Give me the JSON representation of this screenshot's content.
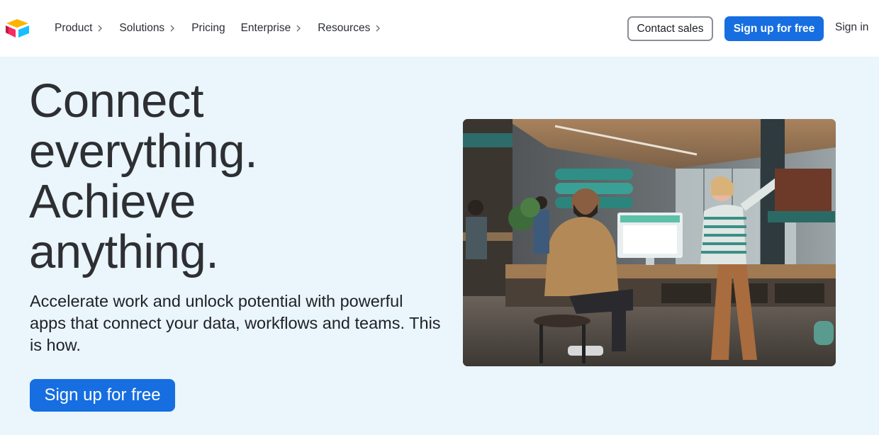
{
  "header": {
    "logo_icon": "airtable-logo-icon",
    "nav": [
      {
        "label": "Product",
        "has_chevron": true
      },
      {
        "label": "Solutions",
        "has_chevron": true
      },
      {
        "label": "Pricing",
        "has_chevron": false
      },
      {
        "label": "Enterprise",
        "has_chevron": true
      },
      {
        "label": "Resources",
        "has_chevron": true
      }
    ],
    "contact_sales": "Contact sales",
    "signup": "Sign up for free",
    "signin": "Sign in"
  },
  "hero": {
    "headline": [
      "Connect",
      "everything.",
      "Achieve",
      "anything."
    ],
    "subcopy": "Accelerate work and unlock potential with powerful apps that connect your data, workflows and teams. This is how.",
    "cta": "Sign up for free",
    "image_alt": "people-working-in-workshop-photo"
  },
  "colors": {
    "primary": "#166ee1",
    "hero_bg": "#eaf5fc",
    "text": "#2d2f33"
  }
}
